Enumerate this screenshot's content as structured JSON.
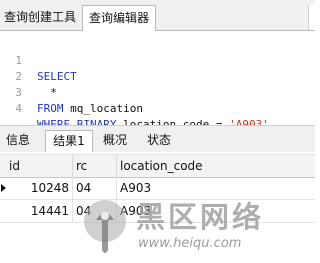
{
  "top_tabs": [
    "查询创建工具",
    "查询编辑器"
  ],
  "editor": {
    "lines": [
      {
        "num": "1",
        "kw": "SELECT",
        "rest": "",
        "str": ""
      },
      {
        "num": "2",
        "kw": "",
        "rest": "  *",
        "str": ""
      },
      {
        "num": "3",
        "kw": "FROM",
        "rest": " mq_location",
        "str": ""
      },
      {
        "num": "4",
        "kw": "WHERE BINARY",
        "rest": " location_code = ",
        "str": "'A903'"
      }
    ]
  },
  "result_tabs": [
    "信息",
    "结果1",
    "概况",
    "状态"
  ],
  "grid": {
    "columns": [
      "id",
      "rc",
      "location_code"
    ],
    "rows": [
      {
        "id": "10248",
        "rc": "04",
        "location_code": "A903"
      },
      {
        "id": "14441",
        "rc": "04",
        "location_code": "A903"
      }
    ]
  },
  "watermark": {
    "title": "黑区网络",
    "url": "www.heiqu.com"
  },
  "colors": {
    "keyword": "#2436b4",
    "string": "#b33a1f",
    "line_number": "#9a9a9a"
  }
}
